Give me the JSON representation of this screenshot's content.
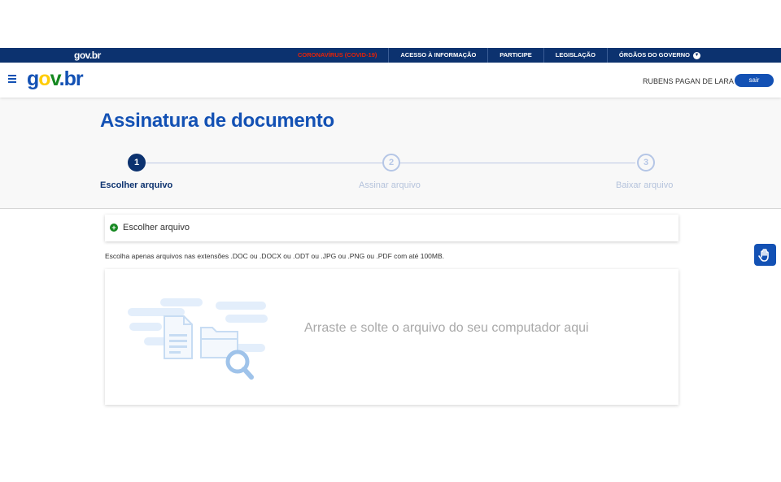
{
  "topbar": {
    "logo": "gov.br",
    "links": [
      {
        "label": "CORONAVÍRUS (COVID-19)",
        "highlight": true
      },
      {
        "label": "ACESSO À INFORMAÇÃO",
        "highlight": false
      },
      {
        "label": "PARTICIPE",
        "highlight": false
      },
      {
        "label": "LEGISLAÇÃO",
        "highlight": false
      },
      {
        "label": "ÓRGÃOS DO GOVERNO",
        "highlight": false
      }
    ]
  },
  "header": {
    "logo": {
      "g": "g",
      "o": "o",
      "v": "v",
      "dot": ".",
      "br": "br"
    },
    "user_name": "RUBENS PAGAN DE LARA",
    "logout_label": "sair"
  },
  "page": {
    "title": "Assinatura de documento",
    "steps": [
      {
        "number": "1",
        "label": "Escolher arquivo",
        "state": "active"
      },
      {
        "number": "2",
        "label": "Assinar arquivo",
        "state": "inactive"
      },
      {
        "number": "3",
        "label": "Baixar arquivo",
        "state": "inactive"
      }
    ]
  },
  "upload": {
    "choose_label": "Escolher arquivo",
    "hint": "Escolha apenas arquivos nas extensões .DOC ou .DOCX ou .ODT ou .JPG ou .PNG ou .PDF com até 100MB.",
    "dropzone_text": "Arraste e solte o arquivo do seu computador aqui"
  },
  "icons": {
    "menu": "hamburger-icon",
    "plus": "plus-circle-icon",
    "chevron": "chevron-down-icon",
    "accessibility": "hand-sign-language-icon",
    "illustration": "files-search-illustration"
  },
  "colors": {
    "primary": "#1351b4",
    "navy": "#0c326f",
    "covid": "#e52207",
    "green": "#168821",
    "yellow": "#ffcd07"
  }
}
